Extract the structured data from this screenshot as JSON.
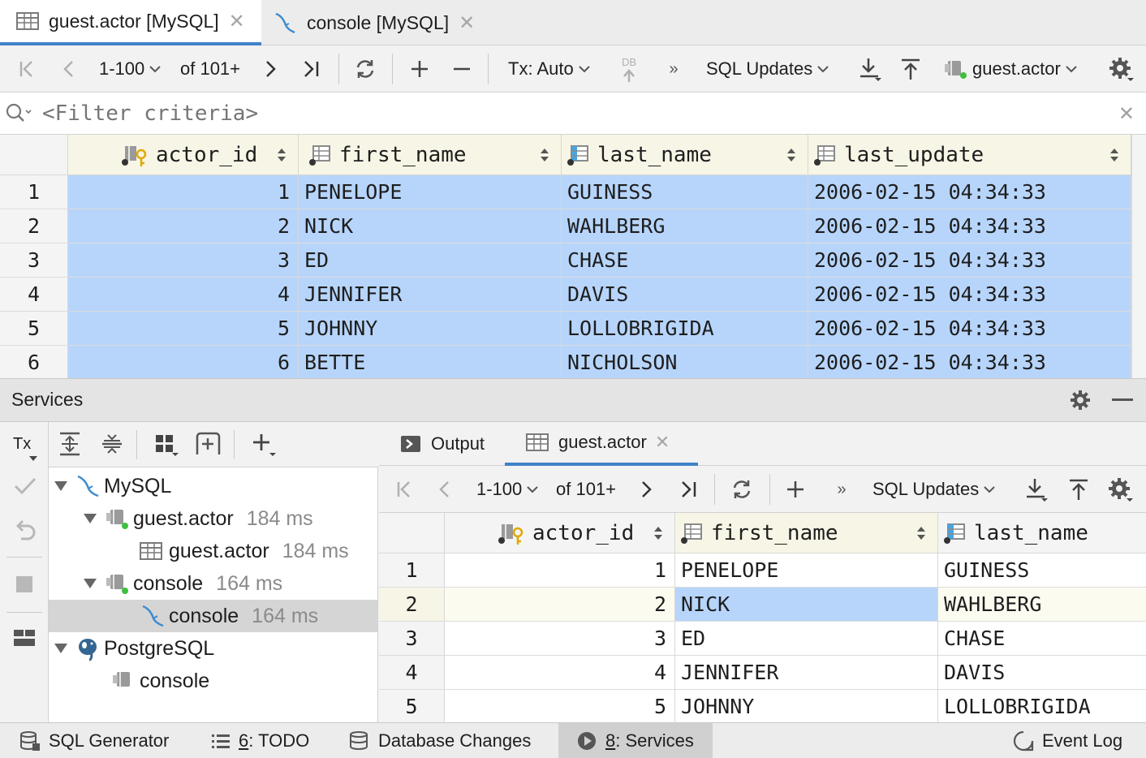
{
  "editor_tabs": [
    {
      "label": "guest.actor [MySQL]",
      "active": true
    },
    {
      "label": "console [MySQL]",
      "active": false
    }
  ],
  "main_toolbar": {
    "page_range": "1-100",
    "of_total": "of 101+",
    "tx_mode": "Tx: Auto",
    "db_label": "DB",
    "sql_updates": "SQL Updates",
    "datasource": "guest.actor"
  },
  "filter": {
    "placeholder": "<Filter criteria>"
  },
  "main_grid": {
    "columns": [
      "actor_id",
      "first_name",
      "last_name",
      "last_update"
    ],
    "rows": [
      [
        "1",
        "1",
        "PENELOPE",
        "GUINESS",
        "2006-02-15 04:34:33"
      ],
      [
        "2",
        "2",
        "NICK",
        "WAHLBERG",
        "2006-02-15 04:34:33"
      ],
      [
        "3",
        "3",
        "ED",
        "CHASE",
        "2006-02-15 04:34:33"
      ],
      [
        "4",
        "4",
        "JENNIFER",
        "DAVIS",
        "2006-02-15 04:34:33"
      ],
      [
        "5",
        "5",
        "JOHNNY",
        "LOLLOBRIGIDA",
        "2006-02-15 04:34:33"
      ],
      [
        "6",
        "6",
        "BETTE",
        "NICHOLSON",
        "2006-02-15 04:34:33"
      ]
    ]
  },
  "services": {
    "title": "Services",
    "tx_label": "Tx",
    "tree": [
      {
        "label": "MySQL",
        "duration": ""
      },
      {
        "label": "guest.actor",
        "duration": "184 ms"
      },
      {
        "label": "guest.actor",
        "duration": "184 ms"
      },
      {
        "label": "console",
        "duration": "164 ms"
      },
      {
        "label": "console",
        "duration": "164 ms"
      },
      {
        "label": "PostgreSQL",
        "duration": ""
      },
      {
        "label": "console",
        "duration": ""
      }
    ],
    "tabs": [
      {
        "label": "Output"
      },
      {
        "label": "guest.actor"
      }
    ],
    "toolbar": {
      "page_range": "1-100",
      "of_total": "of 101+",
      "sql_updates": "SQL Updates"
    },
    "grid": {
      "columns": [
        "actor_id",
        "first_name",
        "last_name"
      ],
      "rows": [
        [
          "1",
          "1",
          "PENELOPE",
          "GUINESS"
        ],
        [
          "2",
          "2",
          "NICK",
          "WAHLBERG"
        ],
        [
          "3",
          "3",
          "ED",
          "CHASE"
        ],
        [
          "4",
          "4",
          "JENNIFER",
          "DAVIS"
        ],
        [
          "5",
          "5",
          "JOHNNY",
          "LOLLOBRIGIDA"
        ]
      ]
    }
  },
  "status_bar": {
    "items": [
      {
        "label": "SQL Generator"
      },
      {
        "number": "6",
        "label": ": TODO"
      },
      {
        "label": "Database Changes"
      },
      {
        "number": "8",
        "label": ": Services"
      },
      {
        "label": "Event Log"
      }
    ]
  },
  "colors": {
    "selection": "#b7d5fb",
    "header_bg": "#f7f5e5",
    "accent": "#4083c9",
    "mysql_blue": "#3f8ccf",
    "status_ok_green": "#3fbf3f"
  }
}
